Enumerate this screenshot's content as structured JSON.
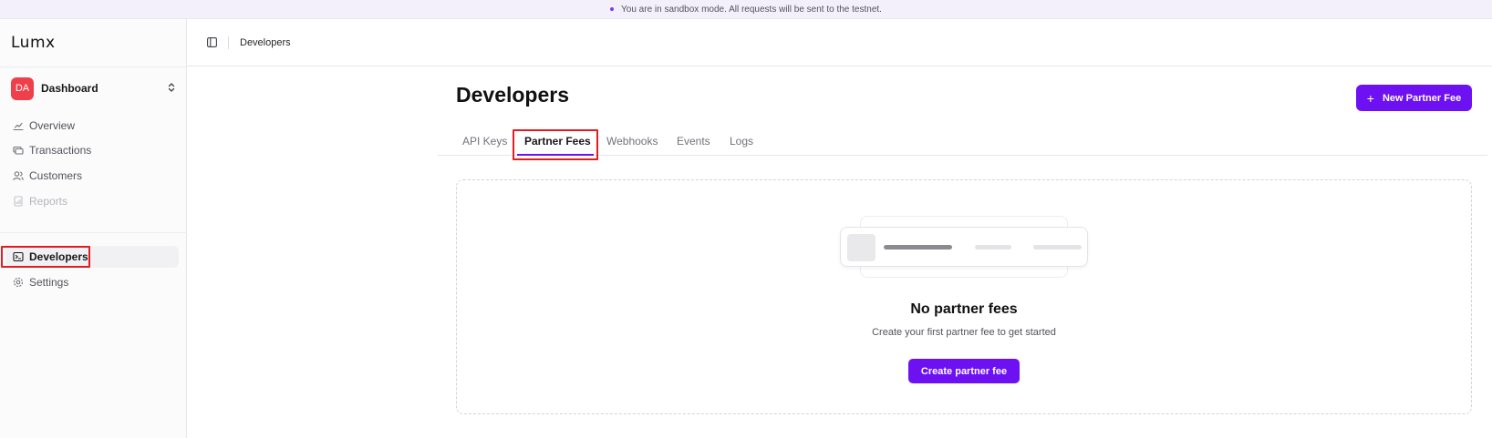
{
  "banner": {
    "text": "You are in sandbox mode. All requests will be sent to the testnet."
  },
  "sidebar": {
    "logo": "Lumx",
    "org": {
      "initials": "DA",
      "name": "Dashboard"
    },
    "items": [
      {
        "label": "Overview",
        "icon": "chart-icon"
      },
      {
        "label": "Transactions",
        "icon": "transactions-icon"
      },
      {
        "label": "Customers",
        "icon": "users-icon"
      },
      {
        "label": "Reports",
        "icon": "report-icon",
        "disabled": true
      },
      {
        "label": "Developers",
        "icon": "terminal-icon",
        "active": true
      },
      {
        "label": "Settings",
        "icon": "gear-icon"
      }
    ]
  },
  "topbar": {
    "breadcrumb": "Developers"
  },
  "main": {
    "title": "Developers",
    "new_button": "New Partner Fee",
    "tabs": [
      "API Keys",
      "Partner Fees",
      "Webhooks",
      "Events",
      "Logs"
    ],
    "active_tab": "Partner Fees",
    "empty": {
      "title": "No partner fees",
      "subtitle": "Create your first partner fee to get started",
      "button": "Create partner fee"
    }
  },
  "colors": {
    "accent": "#6d10f2",
    "avatar": "#ef3f4a",
    "highlight": "#e11d24"
  }
}
